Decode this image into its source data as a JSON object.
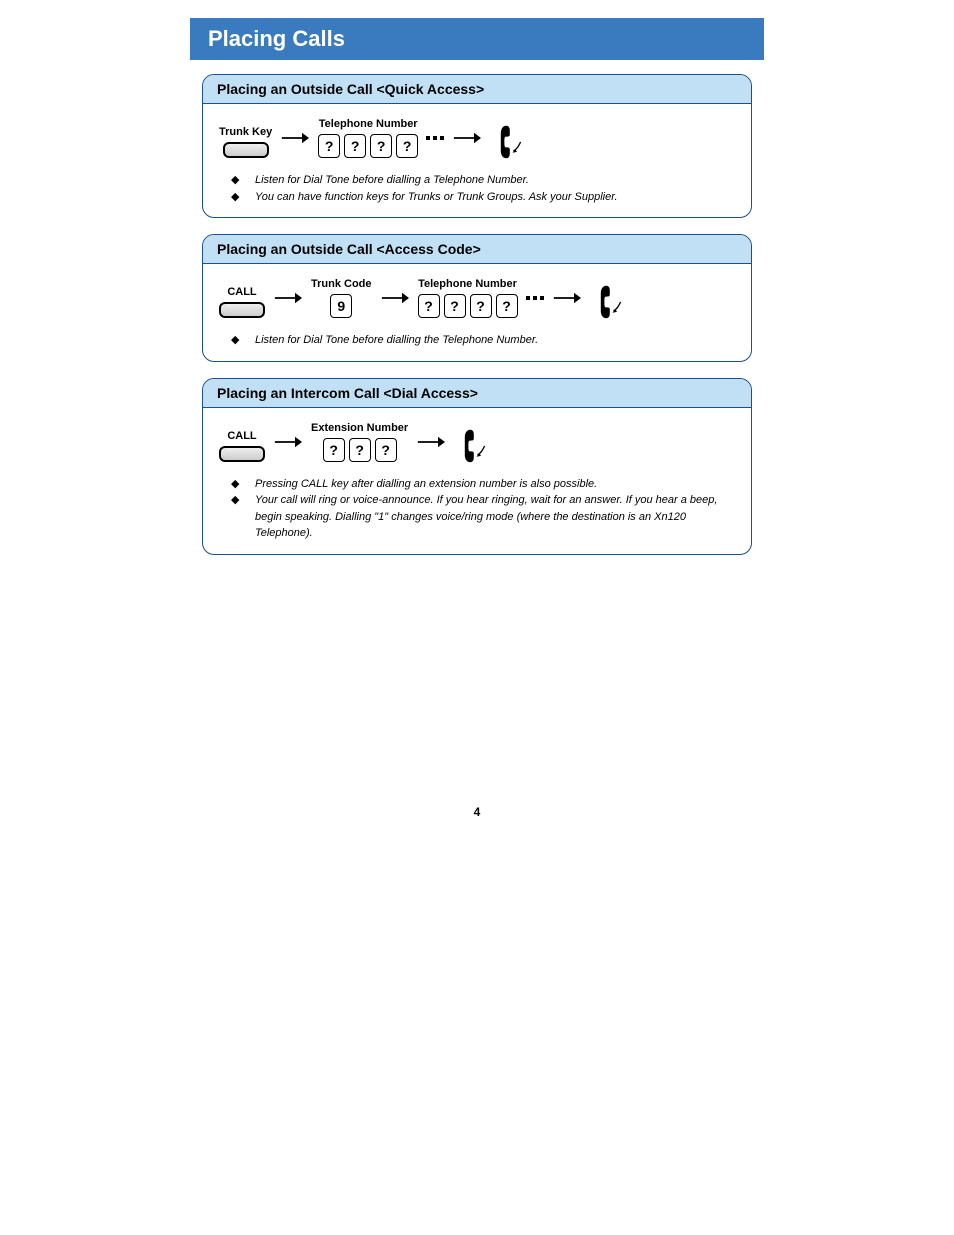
{
  "header": "Placing Calls",
  "page_number": "4",
  "sections": [
    {
      "title": "Placing an Outside Call <Quick Access>",
      "key_label": "Trunk Key",
      "trunk_code_label": "",
      "trunk_code_digit": "",
      "number_label": "Telephone Number",
      "digits": [
        "?",
        "?",
        "?",
        "?"
      ],
      "show_dots": true,
      "notes": [
        "Listen for Dial Tone before dialling a Telephone Number.",
        "You can have function keys for Trunks or Trunk Groups. Ask your Supplier."
      ]
    },
    {
      "title": "Placing an Outside Call <Access Code>",
      "key_label": "CALL",
      "trunk_code_label": "Trunk Code",
      "trunk_code_digit": "9",
      "number_label": "Telephone Number",
      "digits": [
        "?",
        "?",
        "?",
        "?"
      ],
      "show_dots": true,
      "notes": [
        "Listen for Dial Tone before dialling the Telephone Number."
      ]
    },
    {
      "title": "Placing an Intercom Call <Dial Access>",
      "key_label": "CALL",
      "trunk_code_label": "",
      "trunk_code_digit": "",
      "number_label": "Extension Number",
      "digits": [
        "?",
        "?",
        "?"
      ],
      "show_dots": false,
      "notes": [
        "Pressing CALL key after dialling an extension number is also possible.",
        "Your call will ring or voice-announce.   If you hear ringing, wait for an answer.   If you hear a beep, begin speaking.   Dialling \"1\" changes voice/ring mode (where the destination is an Xn120 Telephone)."
      ]
    }
  ]
}
